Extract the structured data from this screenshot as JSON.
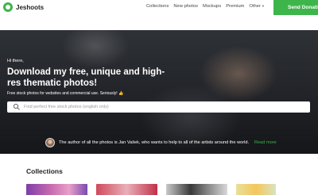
{
  "header": {
    "logo_text": "Jeshoots",
    "nav": [
      "Collections",
      "New photos",
      "Mockups",
      "Premium",
      "Other"
    ],
    "donate_label": "Send Donation"
  },
  "hero": {
    "hello": "Hi there,",
    "headline": "Download my free, unique and high-res thematic photos!",
    "subline": "Free stock photos for websites and commercial use. Seriously! 👍",
    "search_placeholder": "Find perfect free stock photos (english only)",
    "author_text": "The author of all the photos is Jan Vašek, who wants to help to all of the artists around the world.",
    "author_link": "Read more"
  },
  "collections": {
    "title": "Collections"
  },
  "colors": {
    "accent": "#3db54a",
    "hero_bg": "#2c2f35"
  }
}
